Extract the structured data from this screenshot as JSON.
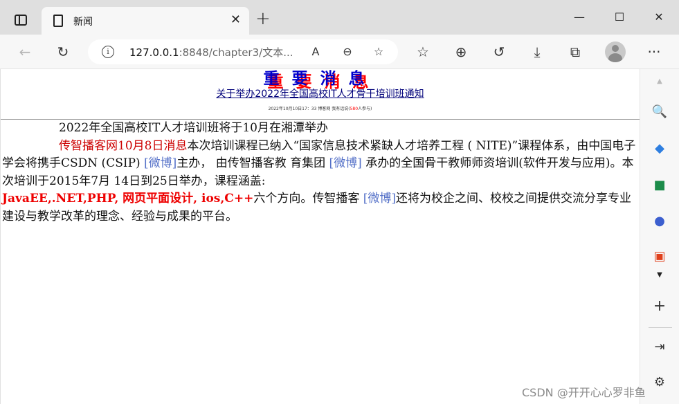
{
  "browser": {
    "tab_title": "新闻",
    "url_host": "127.0.0.1",
    "url_rest": ":8848/chapter3/文本...",
    "tab_close_glyph": "✕",
    "new_tab_glyph": "+",
    "minimize_glyph": "—",
    "maximize_glyph": "☐",
    "close_glyph": "✕",
    "read_aloud_glyph": "A",
    "zoom_out_glyph": "⊖",
    "favorite_add_glyph": "☆",
    "favorites_glyph": "☆",
    "collections_glyph": "⊕",
    "history_glyph": "↺",
    "download_glyph": "⤓",
    "extensions_glyph": "⧉",
    "more_glyph": "···",
    "back_glyph": "←",
    "refresh_glyph": "↻",
    "info_glyph": "i"
  },
  "sidebar": {
    "scroll_up": "▲",
    "search": "🔍",
    "tag": "◆",
    "briefcase": "■",
    "people": "●",
    "office": "▣",
    "scroll_down": "▼",
    "add": "+",
    "share": "⇥",
    "settings": "⚙"
  },
  "page": {
    "main_title": "重要消息",
    "subtitle": "关于举办2022年全国高校IT人才骨干培训班通知",
    "meta_prefix": "2022年10月10日17：33 博客网 我有话说(",
    "meta_count": "580",
    "meta_suffix": "人参与)",
    "p1": "2022年全国高校IT人才培训班将于10月在湘潭举办",
    "p2_lead": "传智播客网10月8日消息",
    "p2_a": "本次培训课程已纳入“国家信息技术紧缺人才培养工程 ( NITE)”课程体系，由中国电子学会将携手CSDN (CSIP) ",
    "weibo1": "[微博]",
    "p2_b": "主办， 由传智播客教 育集团 ",
    "weibo2": "[微博]",
    "p2_c": " 承办的全国骨干教师师资培训(软件开发与应用)。本次培训于2015年7月 14日到25日举办，课程涵盖:",
    "kw1": "JavaEE,.NET,PHP, 网页平面设计, ios,C++",
    "p2_d": "六个方向。传智播客 ",
    "weibo3": "[微博]",
    "p2_e": "还将为校企之间、校校之间提供交流分享专业建设与教学改革的理念、经验与成果的平台。"
  },
  "watermark": "CSDN @开开心心罗非鱼",
  "colors": {
    "title_blue": "#0000cc",
    "title_shadow_red": "#ff0000",
    "lead_red": "#cc0000",
    "link_blue": "#5571c8"
  }
}
